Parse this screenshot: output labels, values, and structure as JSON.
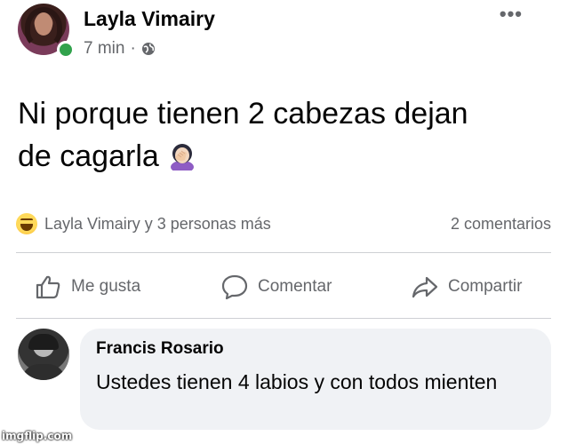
{
  "post": {
    "author": "Layla Vimairy",
    "time": "7 min",
    "separator": "·",
    "privacy_icon": "globe-icon",
    "more_icon": "more-options-icon",
    "more_glyph": "•••",
    "text_line1": "Ni porque tienen 2 cabezas dejan",
    "text_line2": "de cagarla",
    "emoji": "woman-facepalming-emoji"
  },
  "reactions": {
    "icon": "haha-reaction-icon",
    "reactors": "Layla Vimairy y 3 personas más",
    "comments_count": "2 comentarios"
  },
  "actions": [
    {
      "label": "Me gusta",
      "icon": "thumbs-up-icon"
    },
    {
      "label": "Comentar",
      "icon": "comment-bubble-icon"
    },
    {
      "label": "Compartir",
      "icon": "share-arrow-icon"
    }
  ],
  "comment": {
    "author": "Francis Rosario",
    "text": "Ustedes tienen 4 labios y con todos mienten"
  },
  "watermark": "imgflip.com",
  "colors": {
    "background": "#ffffff",
    "primary_text": "#050505",
    "secondary_text": "#65676b",
    "online_green": "#31a24c",
    "comment_bubble": "#f0f2f5",
    "divider": "#ced0d4"
  }
}
